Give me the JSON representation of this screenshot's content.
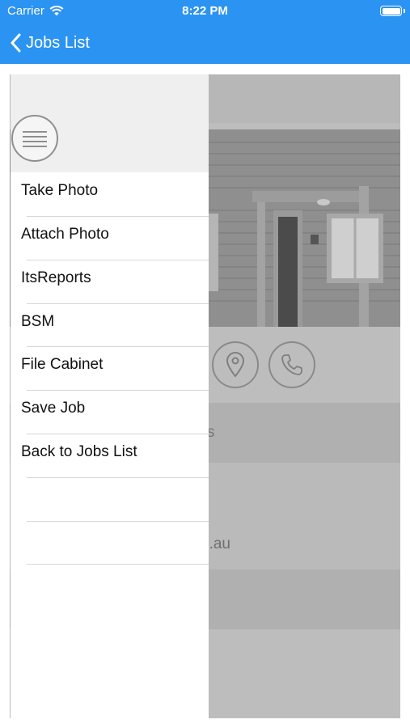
{
  "status_bar": {
    "carrier": "Carrier",
    "time": "8:22 PM"
  },
  "nav": {
    "back_label": "Jobs List"
  },
  "menu": {
    "items": [
      {
        "label": "Take Photo"
      },
      {
        "label": "Attach Photo"
      },
      {
        "label": "ItsReports"
      },
      {
        "label": "BSM"
      },
      {
        "label": "File Cabinet"
      },
      {
        "label": "Save Job"
      },
      {
        "label": "Back to Jobs List"
      }
    ]
  },
  "background_content": {
    "partial_text_1": "s",
    "partial_text_2": "n.au"
  },
  "colors": {
    "nav_bar": "#2b93f1",
    "overlay": "#bdbdbd"
  }
}
